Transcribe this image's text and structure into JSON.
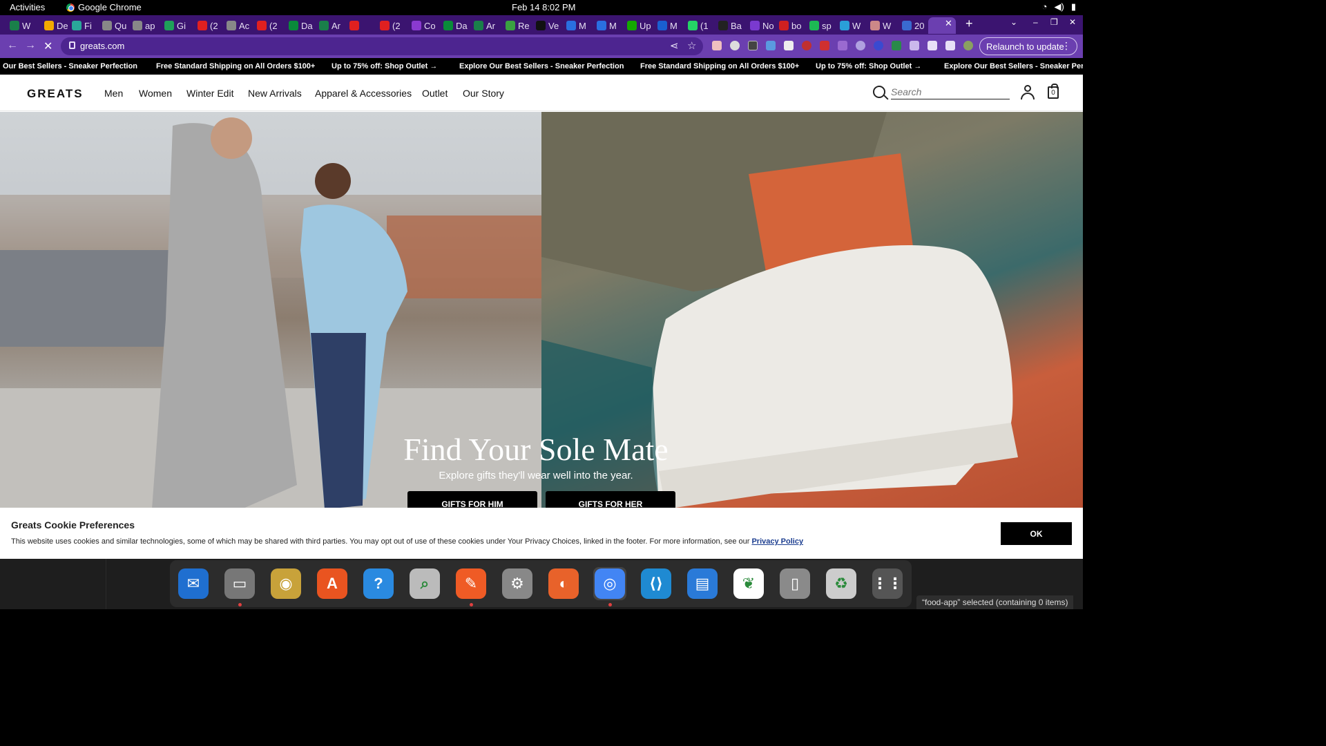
{
  "system": {
    "activities": "Activities",
    "app_name": "Google Chrome",
    "clock": "Feb 14  8:02 PM"
  },
  "tabs": [
    {
      "label": "W",
      "color": "#1a7f4a"
    },
    {
      "label": "De",
      "color": "#f2a900"
    },
    {
      "label": "Fi",
      "color": "#2aa89a"
    },
    {
      "label": "Qu",
      "color": "#888888"
    },
    {
      "label": "ap",
      "color": "#888888"
    },
    {
      "label": "Gi",
      "color": "#1fa05a"
    },
    {
      "label": "(2",
      "color": "#e02020"
    },
    {
      "label": "Ac",
      "color": "#888888"
    },
    {
      "label": "(2",
      "color": "#e02020"
    },
    {
      "label": "Da",
      "color": "#0a8a3a"
    },
    {
      "label": "Ar",
      "color": "#1a7f4a"
    },
    {
      "label": "",
      "color": "#e02020"
    },
    {
      "label": "(2",
      "color": "#e02020"
    },
    {
      "label": "Co",
      "color": "#8a3ad0"
    },
    {
      "label": "Da",
      "color": "#0a8a3a"
    },
    {
      "label": "Ar",
      "color": "#1a7f4a"
    },
    {
      "label": "Re",
      "color": "#3aa040"
    },
    {
      "label": "Ve",
      "color": "#111111"
    },
    {
      "label": "M",
      "color": "#2a6fe0"
    },
    {
      "label": "M",
      "color": "#2a6fe0"
    },
    {
      "label": "Up",
      "color": "#14a800"
    },
    {
      "label": "M",
      "color": "#1a5fd0"
    },
    {
      "label": "(1",
      "color": "#25d366"
    },
    {
      "label": "Ba",
      "color": "#222222"
    },
    {
      "label": "No",
      "color": "#7a3ad0"
    },
    {
      "label": "bo",
      "color": "#d02020"
    },
    {
      "label": "sp",
      "color": "#1db954"
    },
    {
      "label": "W",
      "color": "#2a9fd8"
    },
    {
      "label": "W",
      "color": "#c88"
    },
    {
      "label": "20",
      "color": "#3a6ad0"
    }
  ],
  "browser": {
    "url": "greats.com",
    "relaunch_label": "Relaunch to update"
  },
  "page": {
    "promos": [
      "Our Best Sellers - Sneaker Perfection",
      "Free Standard Shipping on All Orders $100+",
      "Up to 75% off: Shop Outlet →",
      "Explore Our Best Sellers - Sneaker Perfection",
      "Free Standard Shipping on All Orders $100+",
      "Up to 75% off: Shop Outlet →",
      "Explore Our Best Sellers - Sneaker Perfecti"
    ],
    "logo": "GREATS",
    "nav": [
      "Men",
      "Women",
      "Winter Edit",
      "New Arrivals",
      "Apparel & Accessories",
      "Outlet",
      "Our Story"
    ],
    "search_placeholder": "Search",
    "cart_count": "0",
    "hero": {
      "title": "Find Your Sole Mate",
      "subtitle": "Explore gifts they'll wear well into the year.",
      "btn_him": "GIFTS FOR HIM",
      "btn_her": "GIFTS FOR HER"
    },
    "cookie": {
      "title": "Greats Cookie Preferences",
      "body": "This website uses cookies and similar technologies, some of which may be shared with third parties. You may opt out of use of these cookies under Your Privacy Choices, linked in the footer. For more information, see our ",
      "link": "Privacy Policy",
      "ok": "OK"
    }
  },
  "dock": [
    {
      "name": "thunderbird-icon",
      "color": "#1f6fd0",
      "glyph": "✉",
      "running": false
    },
    {
      "name": "files-icon",
      "color": "#777777",
      "glyph": "▭",
      "running": true
    },
    {
      "name": "rhythmbox-icon",
      "color": "#c8a23a",
      "glyph": "◉",
      "running": false
    },
    {
      "name": "app-center-icon",
      "color": "#e95420",
      "glyph": "A",
      "running": false
    },
    {
      "name": "help-icon",
      "color": "#2a8ae0",
      "glyph": "?",
      "running": false
    },
    {
      "name": "image-viewer-icon",
      "color": "#bbbbbb",
      "glyph": "⌕",
      "running": false
    },
    {
      "name": "postman-icon",
      "color": "#ef5b25",
      "glyph": "✎",
      "running": true
    },
    {
      "name": "settings-icon",
      "color": "#888888",
      "glyph": "⚙",
      "running": false
    },
    {
      "name": "firefox-icon",
      "color": "#e8622a",
      "glyph": "◐",
      "running": false
    },
    {
      "name": "chrome-icon",
      "color": "#4285f4",
      "glyph": "◎",
      "running": true
    },
    {
      "name": "vscode-icon",
      "color": "#1f8ad2",
      "glyph": "⟨⟩",
      "running": false
    },
    {
      "name": "writer-icon",
      "color": "#2a7ad8",
      "glyph": "▤",
      "running": false
    },
    {
      "name": "mongodb-compass-icon",
      "color": "#ffffff",
      "glyph": "❦",
      "running": false
    },
    {
      "name": "disks-icon",
      "color": "#8a8a8a",
      "glyph": "▯",
      "running": false
    },
    {
      "name": "trash-icon",
      "color": "#cccccc",
      "glyph": "♻",
      "running": false
    },
    {
      "name": "show-apps-icon",
      "color": "#555555",
      "glyph": "⋮⋮",
      "running": false
    }
  ],
  "status": "“food-app” selected  (containing 0 items)"
}
